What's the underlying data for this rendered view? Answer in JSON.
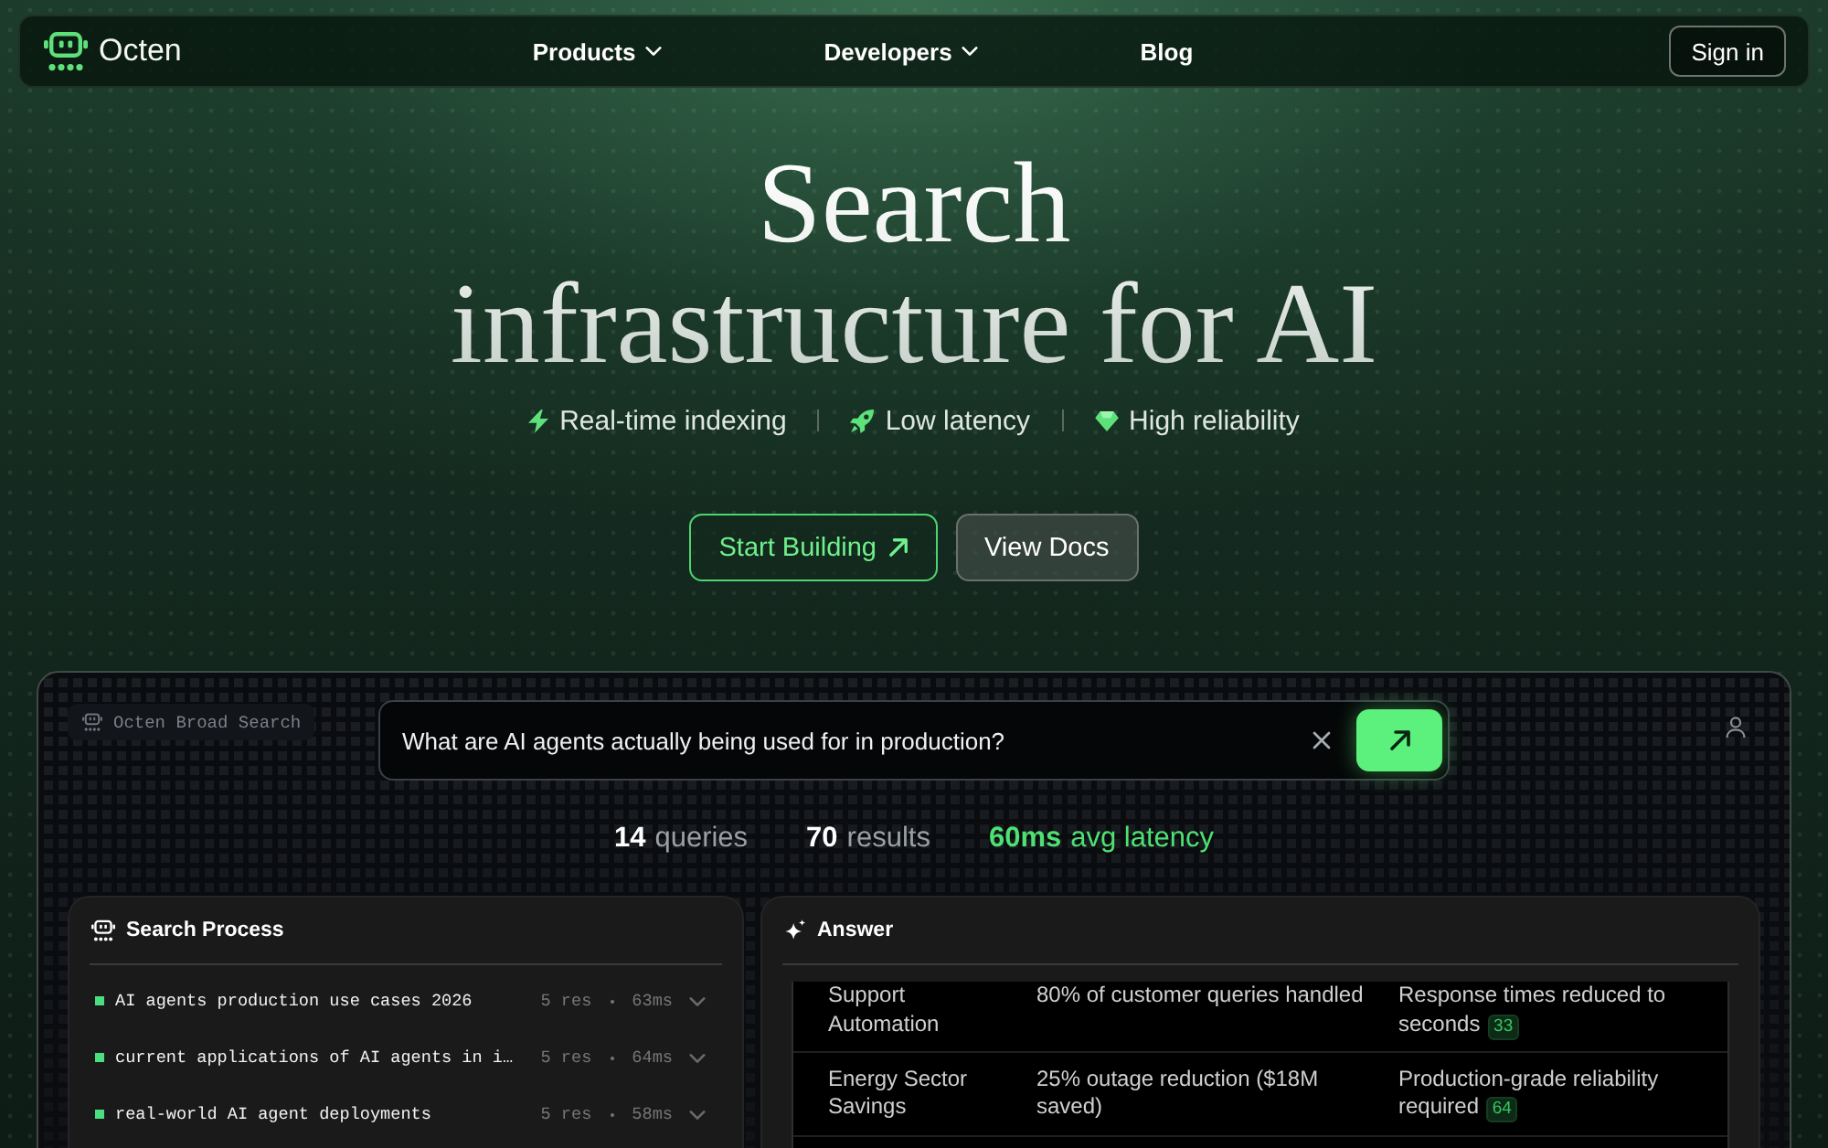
{
  "nav": {
    "logo": "Octen",
    "links": [
      {
        "label": "Products",
        "dropdown": true
      },
      {
        "label": "Developers",
        "dropdown": true
      },
      {
        "label": "Blog",
        "dropdown": false
      }
    ],
    "sign_in": "Sign in"
  },
  "hero": {
    "title": "Search infrastructure for AI",
    "features": [
      "Real-time indexing",
      "Low latency",
      "High reliability"
    ],
    "buttons": [
      {
        "label": "Start Building",
        "kind": "primary"
      },
      {
        "label": "View Docs",
        "kind": "secondary"
      }
    ]
  },
  "demo": {
    "mode": "Octen Broad Search",
    "query": "What are AI agents actually being used for in production?",
    "stats": [
      {
        "value": "14",
        "label": "queries",
        "highlight": false
      },
      {
        "value": "70",
        "label": "results",
        "highlight": false
      },
      {
        "value": "60ms",
        "label": "avg latency",
        "highlight": true
      }
    ],
    "search_process": {
      "title": "Search Process",
      "queries": [
        {
          "text": "AI agents production use cases 2026",
          "results": "5 res",
          "time": "63ms",
          "expanded": false
        },
        {
          "text": "current applications of AI agents in i…",
          "results": "5 res",
          "time": "64ms",
          "expanded": false
        },
        {
          "text": "real-world AI agent deployments",
          "results": "5 res",
          "time": "58ms",
          "expanded": false
        }
      ]
    },
    "answer": {
      "title": "Answer",
      "rows": [
        {
          "cells": [
            "Support Automation",
            "80% of customer queries handled",
            "Response times reduced to seconds"
          ],
          "citation": "33"
        },
        {
          "cells": [
            "Energy Sector Savings",
            "25% outage reduction ($18M saved)",
            "Production-grade reliability required"
          ],
          "citation": "64"
        }
      ]
    }
  }
}
